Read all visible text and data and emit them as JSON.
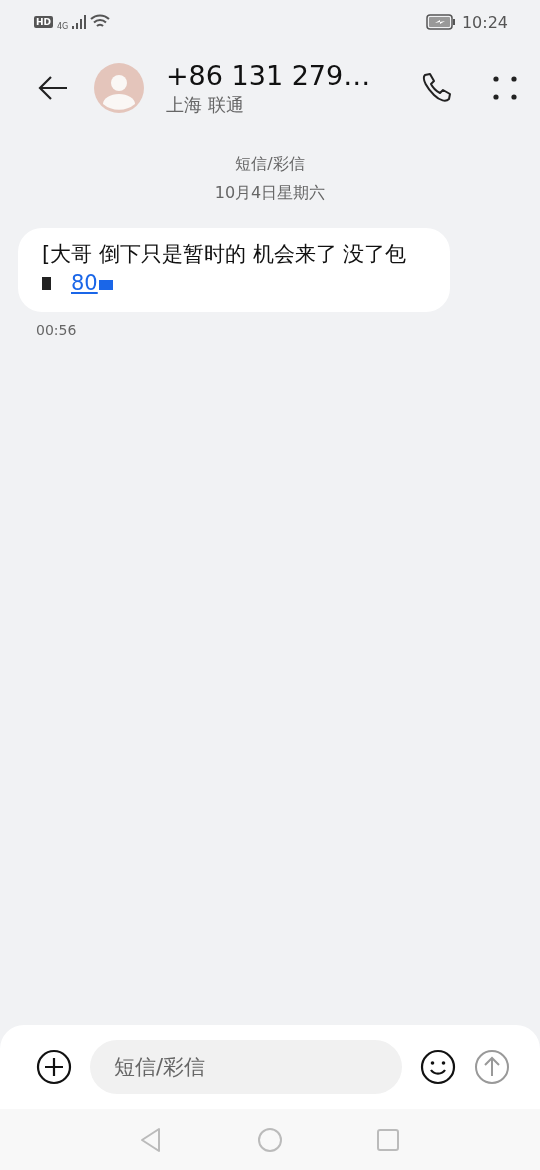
{
  "status_bar": {
    "hd": "HD",
    "network": "4G",
    "time": "10:24"
  },
  "header": {
    "title": "+86 131 279…",
    "subtitle": "上海 联通"
  },
  "thread": {
    "channel": "短信/彩信",
    "date": "10月4日星期六"
  },
  "messages": [
    {
      "text": "[大哥 倒下只是暂时的 机会来了 没了包",
      "link": "80",
      "time": "00:56"
    }
  ],
  "composer": {
    "placeholder": "短信/彩信"
  }
}
